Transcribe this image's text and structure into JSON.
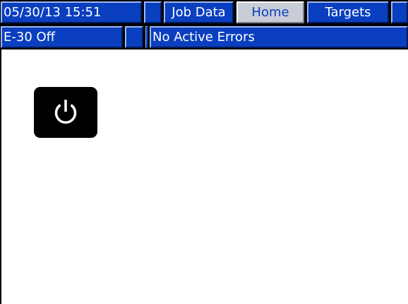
{
  "header": {
    "datetime": "05/30/13 15:51",
    "tabs": [
      {
        "label": "Job Data",
        "active": false
      },
      {
        "label": "Home",
        "active": true
      },
      {
        "label": "Targets",
        "active": false
      }
    ]
  },
  "status_bar": {
    "system_status": "E-30 Off",
    "error_message": "No Active Errors"
  },
  "main": {
    "power_button": {
      "icon": "power-icon"
    }
  },
  "colors": {
    "header_blue": "#0a3fbf",
    "active_tab_bg": "#c9cdd6",
    "power_button_bg": "#000000"
  }
}
